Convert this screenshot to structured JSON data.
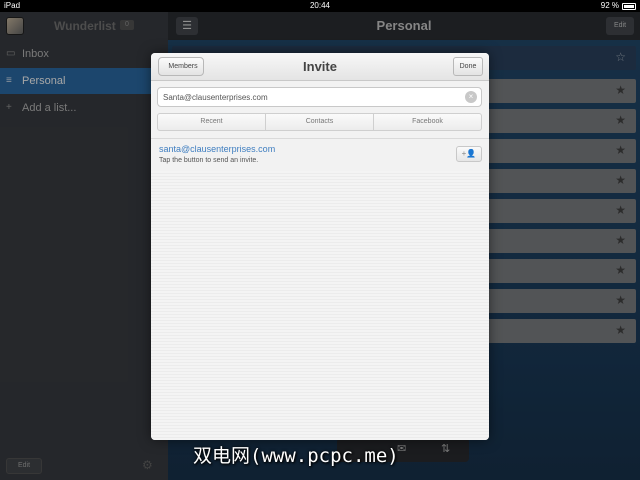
{
  "status_bar": {
    "device": "iPad",
    "time": "20:44",
    "battery": "92 %"
  },
  "sidebar": {
    "app_title": "Wunderlist",
    "badge": "0",
    "items": [
      {
        "label": "Inbox",
        "icon": "inbox-icon"
      },
      {
        "label": "Personal",
        "icon": "list-icon"
      },
      {
        "label": "Add a list...",
        "icon": "plus-icon"
      }
    ],
    "edit_label": "Edit"
  },
  "main": {
    "title": "Personal",
    "edit_label": "Edit"
  },
  "modal": {
    "back_label": "Members",
    "title": "Invite",
    "done_label": "Done",
    "search_value": "Santa@clausenterprises.com",
    "segments": [
      "Recent",
      "Contacts",
      "Facebook"
    ],
    "result_email": "santa@clausenterprises.com",
    "result_hint": "Tap the button to send an invite."
  },
  "watermark": "双电网(www.pcpc.me)",
  "colors": {
    "accent": "#2b6ca8",
    "link": "#3f7ec0"
  }
}
